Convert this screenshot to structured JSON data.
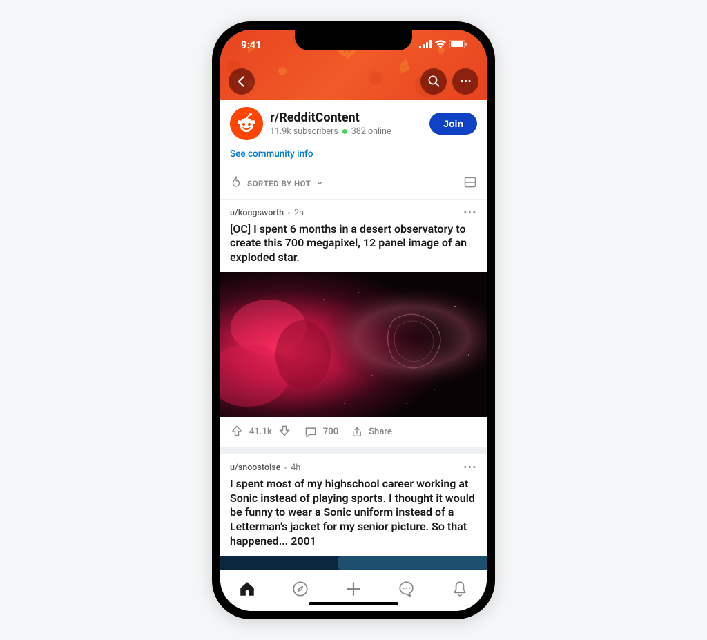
{
  "status": {
    "time": "9:41"
  },
  "community": {
    "name": "r/RedditContent",
    "subscribers_text": "11.9k subscribers",
    "online_text": "382 online",
    "join_label": "Join",
    "see_info_label": "See community info"
  },
  "sort": {
    "label": "SORTED BY HOT"
  },
  "posts": [
    {
      "author": "u/kongsworth",
      "age": "2h",
      "title": "[OC] I spent 6 months in a desert observatory to create this 700 megapixel, 12 panel image of an exploded star.",
      "upvotes": "41.1k",
      "comments": "700",
      "share_label": "Share"
    },
    {
      "author": "u/snoostoise",
      "age": "4h",
      "title": "I spent most of my highschool career working at Sonic instead of playing sports. I thought it would be funny to wear a Sonic uniform instead of a Letterman's jacket for my senior picture. So that happened... 2001"
    }
  ]
}
